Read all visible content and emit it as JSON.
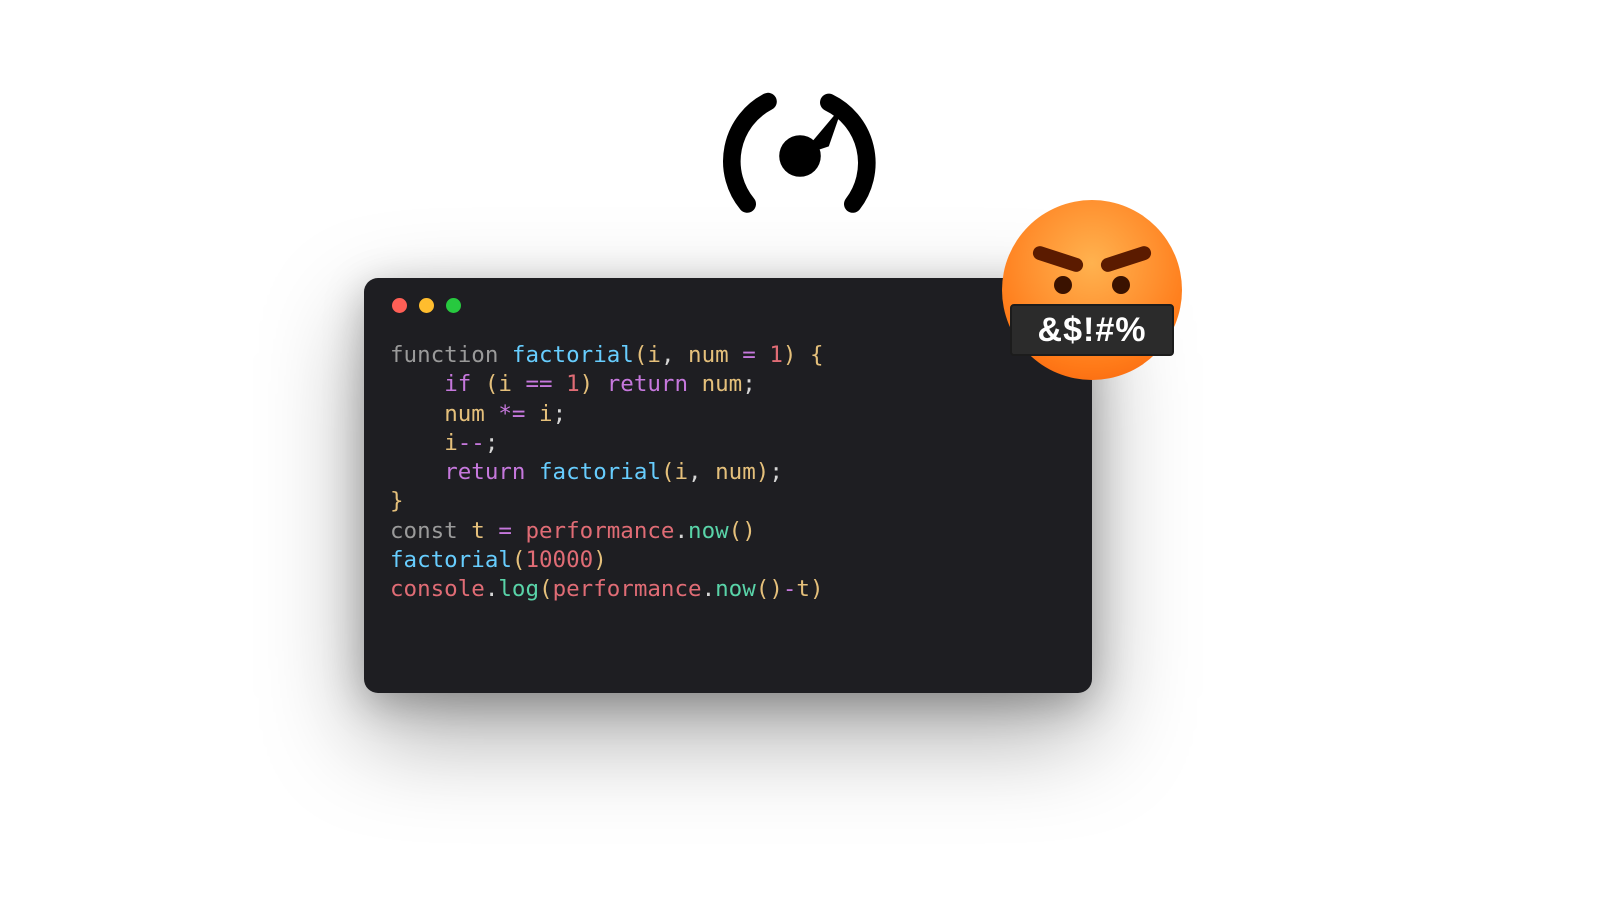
{
  "traffic_colors": {
    "close": "#ff5f56",
    "minimize": "#ffbd2e",
    "zoom": "#27c93f"
  },
  "emoji_text": "&$!#%",
  "code": {
    "line1": {
      "kw_function": "function",
      "fn_name": "factorial",
      "p_open": "(",
      "arg_i": "i",
      "comma1": ",",
      "arg_num": "num",
      "op_assign": "=",
      "num_1": "1",
      "p_close": ")",
      "brace_open": "{"
    },
    "line2": {
      "kw_if": "if",
      "p_open": "(",
      "var_i": "i",
      "op_eq": "==",
      "num_1": "1",
      "p_close": ")",
      "kw_return": "return",
      "var_num": "num",
      "semi": ";"
    },
    "line3": {
      "var_num": "num",
      "op_muleq": "*=",
      "var_i": "i",
      "semi": ";"
    },
    "line4": {
      "var_i": "i",
      "op_dec": "--",
      "semi": ";"
    },
    "line5": {
      "kw_return": "return",
      "fn_name": "factorial",
      "p_open": "(",
      "var_i": "i",
      "comma": ",",
      "var_num": "num",
      "p_close": ")",
      "semi": ";"
    },
    "line6": {
      "brace_close": "}"
    },
    "line7": {
      "kw_const": "const",
      "var_t": "t",
      "op_assign": "=",
      "obj": "performance",
      "dot": ".",
      "method": "now",
      "p_open": "(",
      "p_close": ")"
    },
    "line8": {
      "fn_name": "factorial",
      "p_open": "(",
      "num": "10000",
      "p_close": ")"
    },
    "line9": {
      "obj1": "console",
      "dot1": ".",
      "method1": "log",
      "p_open1": "(",
      "obj2": "performance",
      "dot2": ".",
      "method2": "now",
      "p_open2": "(",
      "p_close2": ")",
      "op_minus": "-",
      "var_t": "t",
      "p_close1": ")"
    }
  }
}
